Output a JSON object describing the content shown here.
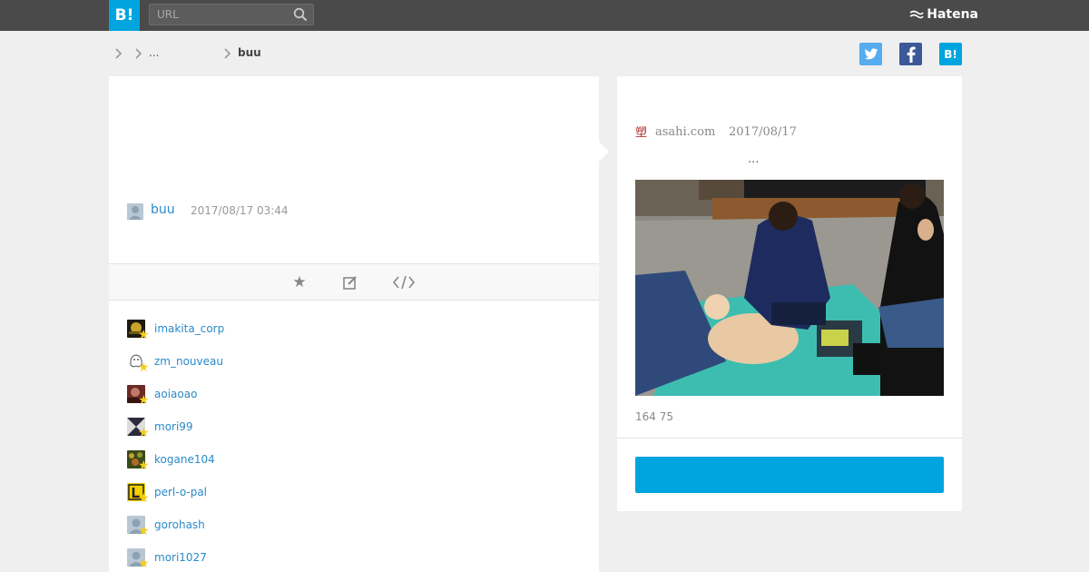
{
  "header": {
    "logo": "B!",
    "search_placeholder": "URL",
    "brand": "Hatena"
  },
  "breadcrumb": {
    "middle": "...",
    "current": "buu"
  },
  "share": {
    "hatena_label": "B!"
  },
  "entry": {
    "author": "buu",
    "timestamp": "2017/08/17 03:44"
  },
  "users": [
    {
      "name": "imakita_corp",
      "avatar_color": "#1d1a0e"
    },
    {
      "name": "zm_nouveau",
      "avatar_color": "#ffffff"
    },
    {
      "name": "aoiaoao",
      "avatar_color": "#6b2a24"
    },
    {
      "name": "mori99",
      "avatar_color": "#2b2b3a"
    },
    {
      "name": "kogane104",
      "avatar_color": "#5a6b2a"
    },
    {
      "name": "perl-o-pal",
      "avatar_color": "#f2d100"
    },
    {
      "name": "gorohash",
      "avatar_color": "#b9c7d4"
    },
    {
      "name": "mori1027",
      "avatar_color": "#b9c7d4"
    }
  ],
  "article": {
    "source_icon": "塑",
    "source": "asahi.com",
    "date": "2017/08/17",
    "excerpt": "...",
    "counts": "164 75"
  },
  "colors": {
    "accent": "#00a4de",
    "link": "#2a8ac8",
    "star": "#f5cd1a"
  }
}
